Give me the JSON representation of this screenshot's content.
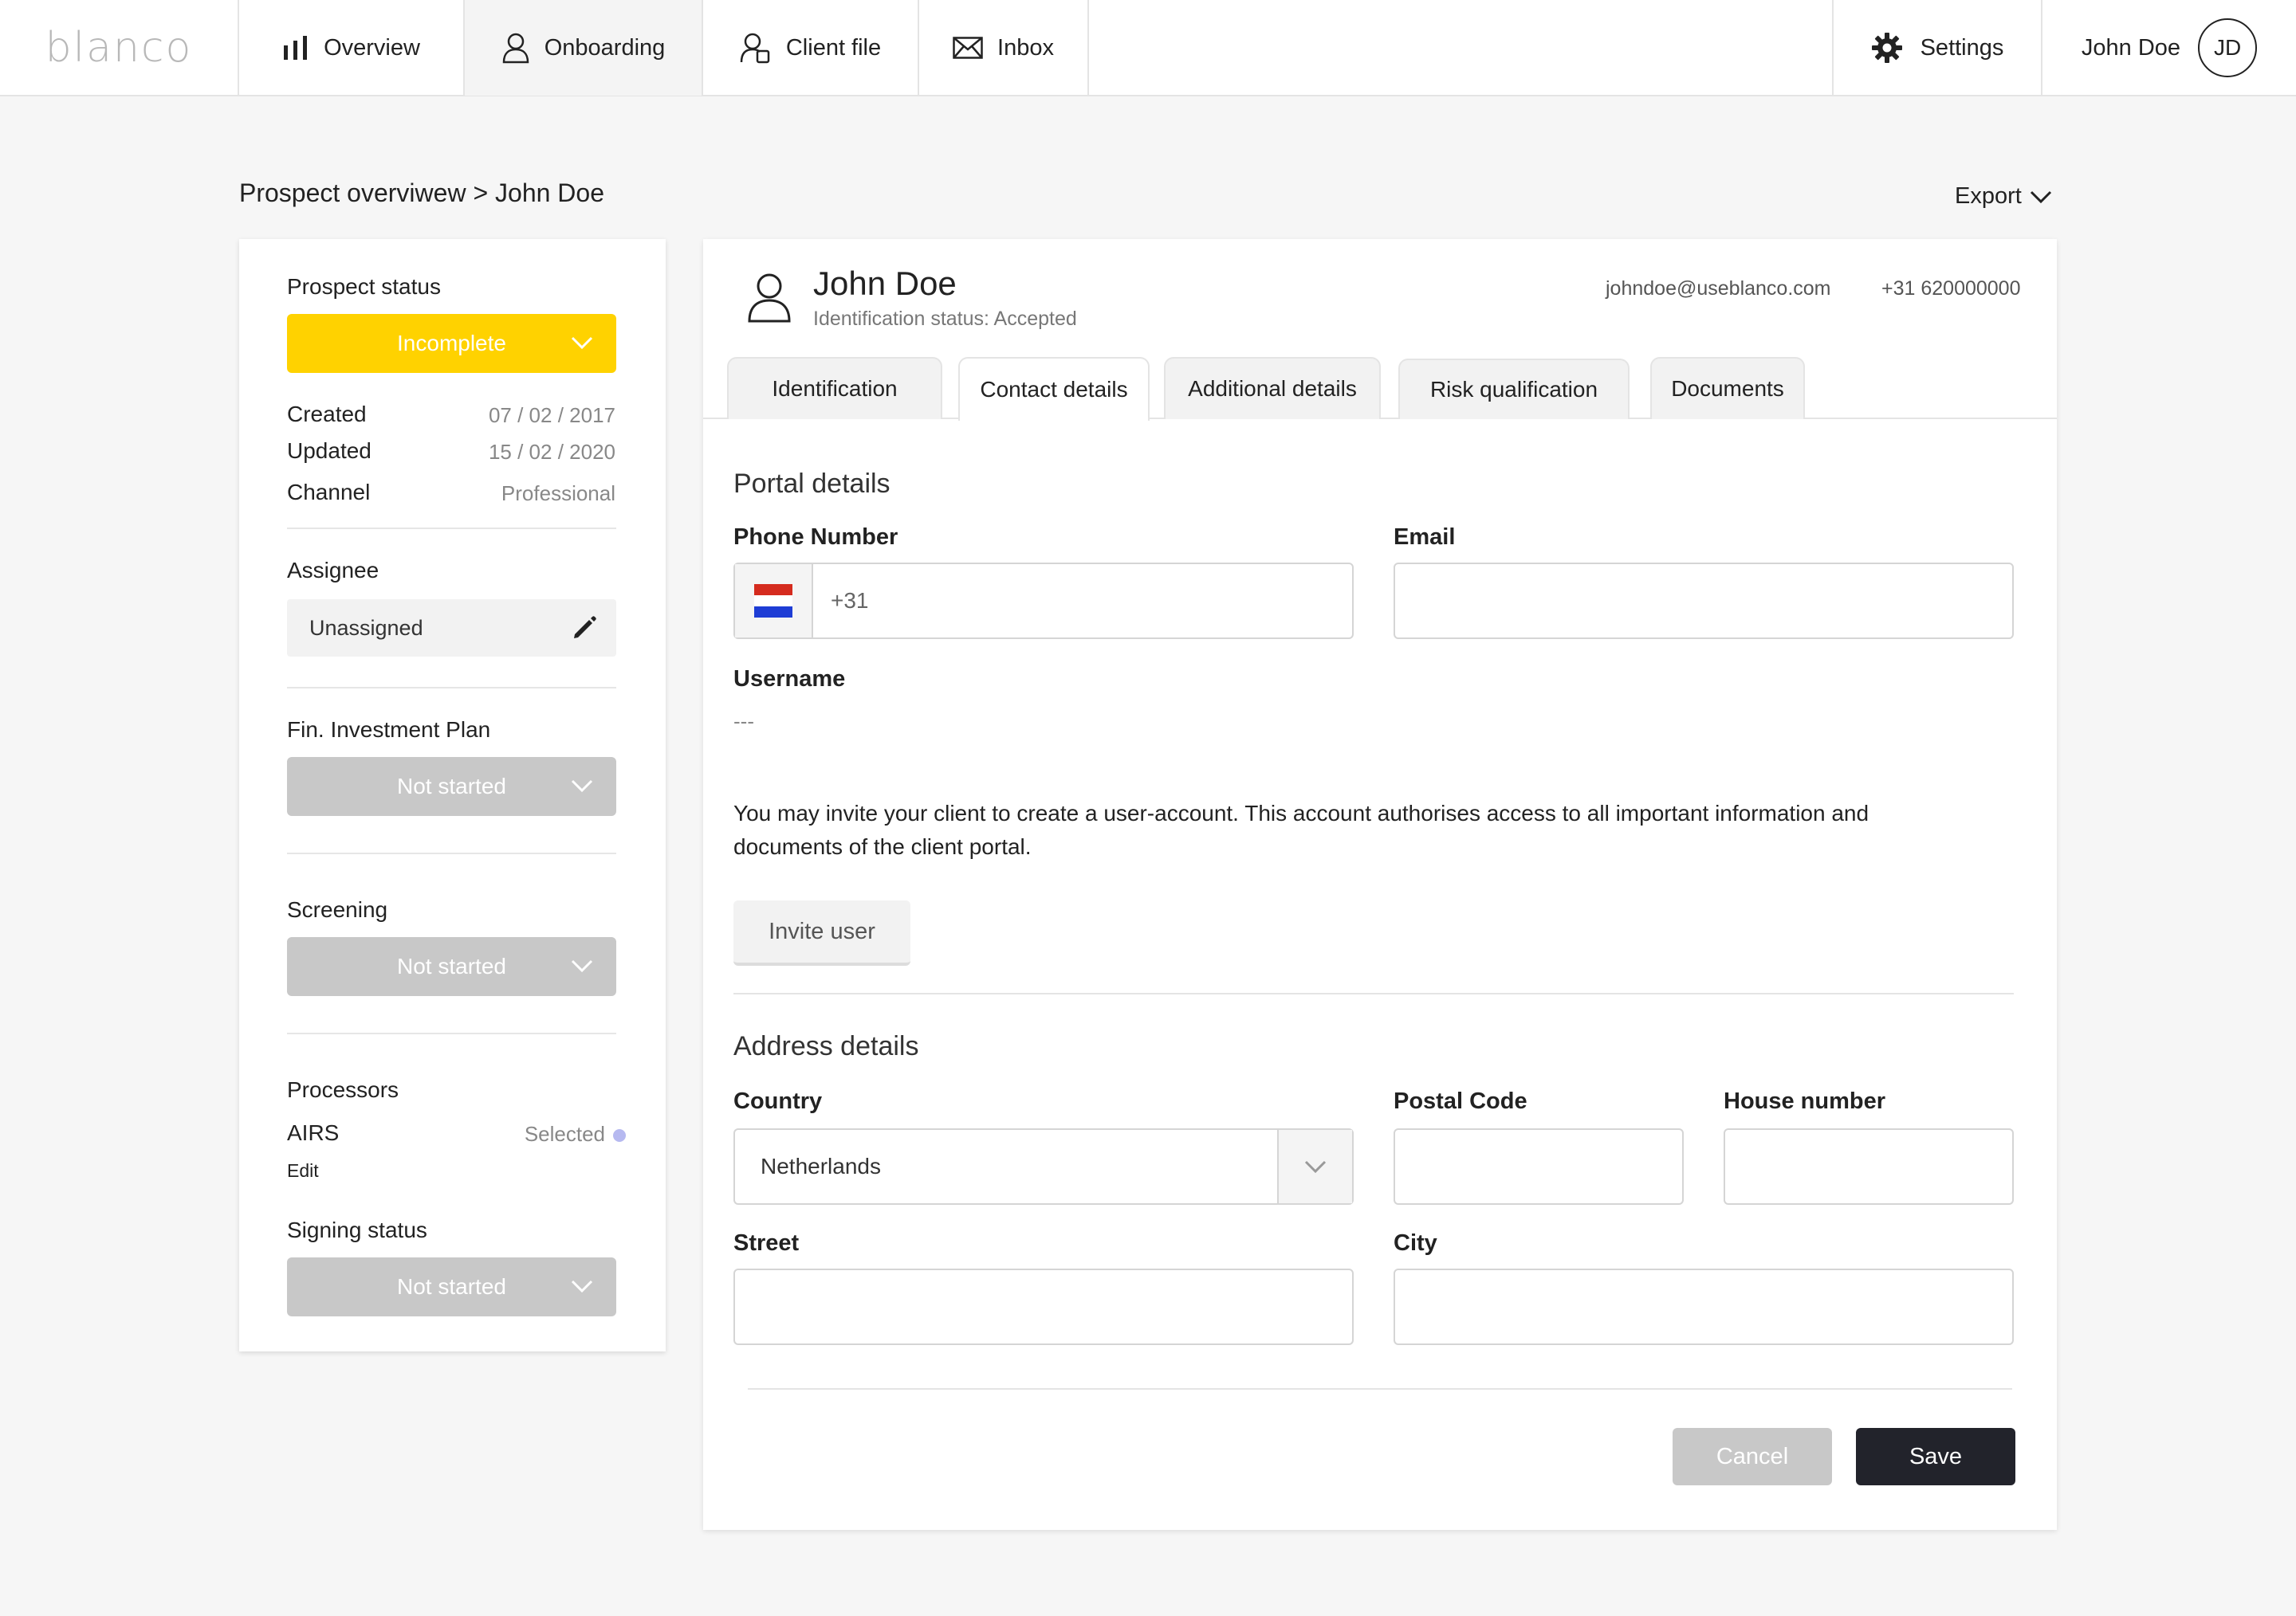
{
  "brand": {
    "logo_text": "blanco"
  },
  "nav": {
    "tabs": [
      {
        "label": "Overview",
        "icon": "bar-chart-icon"
      },
      {
        "label": "Onboarding",
        "icon": "person-icon",
        "active": true
      },
      {
        "label": "Client file",
        "icon": "person-file-icon"
      },
      {
        "label": "Inbox",
        "icon": "envelope-icon"
      }
    ],
    "settings_label": "Settings",
    "user_name": "John Doe",
    "user_initials": "JD"
  },
  "breadcrumb": "Prospect overviwew > John Doe",
  "export_label": "Export",
  "left": {
    "prospect_status_label": "Prospect status",
    "prospect_status_value": "Incomplete",
    "created_label": "Created",
    "created_value": "07 / 02 / 2017",
    "updated_label": "Updated",
    "updated_value": "15 / 02 / 2020",
    "channel_label": "Channel",
    "channel_value": "Professional",
    "assignee_label": "Assignee",
    "assignee_value": "Unassigned",
    "fip_label": "Fin. Investment Plan",
    "fip_value": "Not started",
    "screening_label": "Screening",
    "screening_value": "Not started",
    "processors_label": "Processors",
    "processor_name": "AIRS",
    "processor_status": "Selected",
    "processor_edit": "Edit",
    "signing_label": "Signing status",
    "signing_value": "Not started"
  },
  "client": {
    "name": "John Doe",
    "identification_status": "Identification status: Accepted",
    "email": "johndoe@useblanco.com",
    "phone": "+31 620000000"
  },
  "tabs": [
    {
      "label": "Identification"
    },
    {
      "label": "Contact details",
      "active": true
    },
    {
      "label": "Additional details"
    },
    {
      "label": "Risk qualification"
    },
    {
      "label": "Documents"
    }
  ],
  "portal": {
    "title": "Portal details",
    "phone_label": "Phone Number",
    "phone_prefix": "+31",
    "email_label": "Email",
    "email_value": "",
    "username_label": "Username",
    "username_value": "---",
    "info": "You may invite your client to create a user-account. This account authorises access to all important information and documents of the client portal.",
    "invite_label": "Invite user"
  },
  "address": {
    "title": "Address details",
    "country_label": "Country",
    "country_value": "Netherlands",
    "postal_label": "Postal Code",
    "postal_value": "",
    "house_label": "House number",
    "house_value": "",
    "street_label": "Street",
    "street_value": "",
    "city_label": "City",
    "city_value": ""
  },
  "actions": {
    "cancel_label": "Cancel",
    "save_label": "Save"
  },
  "colors": {
    "status_incomplete": "#FFD200",
    "status_not_started": "#C8C8C8",
    "save_button": "#22232B",
    "processor_dot": "#B6B9F0",
    "flag_red": "#D52B1E",
    "flag_blue": "#1E3DD5"
  }
}
